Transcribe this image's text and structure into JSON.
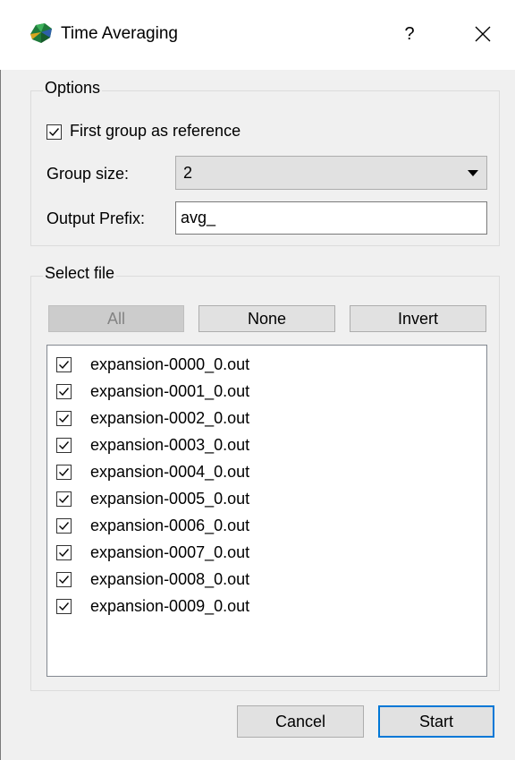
{
  "window": {
    "title": "Time Averaging",
    "help_label": "?",
    "close_label": "×"
  },
  "options": {
    "group_title": "Options",
    "first_group_reference": {
      "label": "First group as reference",
      "checked": true
    },
    "group_size": {
      "label": "Group size:",
      "value": "2"
    },
    "output_prefix": {
      "label": "Output Prefix:",
      "value": "avg_"
    }
  },
  "select_file": {
    "group_title": "Select file",
    "buttons": {
      "all": "All",
      "none": "None",
      "invert": "Invert"
    },
    "files": [
      {
        "name": "expansion-0000_0.out",
        "checked": true
      },
      {
        "name": "expansion-0001_0.out",
        "checked": true
      },
      {
        "name": "expansion-0002_0.out",
        "checked": true
      },
      {
        "name": "expansion-0003_0.out",
        "checked": true
      },
      {
        "name": "expansion-0004_0.out",
        "checked": true
      },
      {
        "name": "expansion-0005_0.out",
        "checked": true
      },
      {
        "name": "expansion-0006_0.out",
        "checked": true
      },
      {
        "name": "expansion-0007_0.out",
        "checked": true
      },
      {
        "name": "expansion-0008_0.out",
        "checked": true
      },
      {
        "name": "expansion-0009_0.out",
        "checked": true
      }
    ]
  },
  "footer": {
    "cancel_label": "Cancel",
    "start_label": "Start"
  },
  "colors": {
    "accent": "#0078d7",
    "background": "#f0f0f0",
    "button_face": "#e1e1e1"
  }
}
